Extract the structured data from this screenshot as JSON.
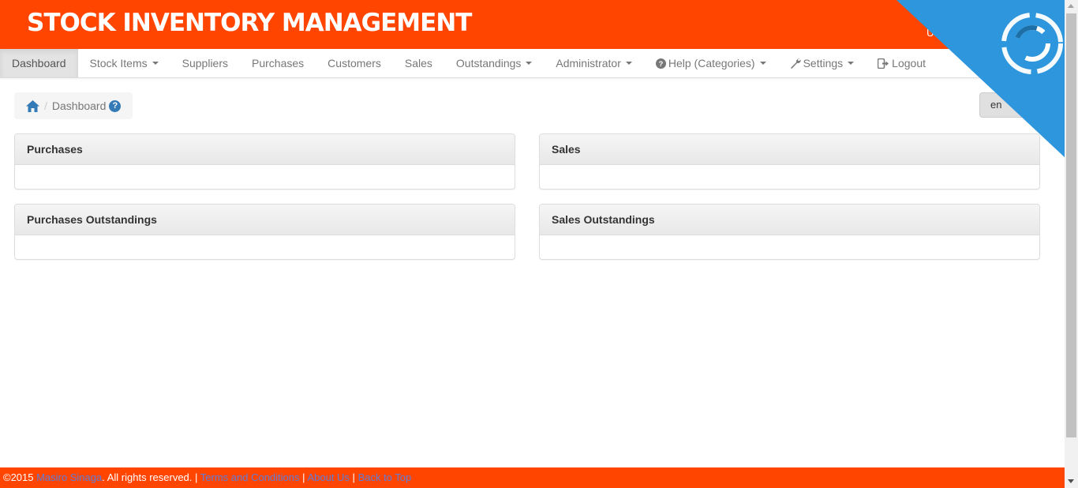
{
  "header": {
    "title": "STOCK INVENTORY MANAGEMENT",
    "user_label": "User Nan"
  },
  "nav": {
    "items": [
      {
        "label": "Dashboard",
        "active": true,
        "dropdown": false,
        "icon": ""
      },
      {
        "label": "Stock Items",
        "active": false,
        "dropdown": true,
        "icon": ""
      },
      {
        "label": "Suppliers",
        "active": false,
        "dropdown": false,
        "icon": ""
      },
      {
        "label": "Purchases",
        "active": false,
        "dropdown": false,
        "icon": ""
      },
      {
        "label": "Customers",
        "active": false,
        "dropdown": false,
        "icon": ""
      },
      {
        "label": "Sales",
        "active": false,
        "dropdown": false,
        "icon": ""
      },
      {
        "label": "Outstandings",
        "active": false,
        "dropdown": true,
        "icon": ""
      },
      {
        "label": "Administrator",
        "active": false,
        "dropdown": true,
        "icon": ""
      },
      {
        "label": "Help (Categories)",
        "active": false,
        "dropdown": true,
        "icon": "question-circle-icon"
      },
      {
        "label": "Settings",
        "active": false,
        "dropdown": true,
        "icon": "wrench-icon"
      },
      {
        "label": "Logout",
        "active": false,
        "dropdown": false,
        "icon": "logout-icon"
      }
    ]
  },
  "breadcrumb": {
    "home_icon": "home-icon",
    "separator": "/",
    "current": "Dashboard",
    "help_icon": "question-circle-icon",
    "help_glyph": "?"
  },
  "language": {
    "value": "en"
  },
  "panels": [
    {
      "title": "Purchases"
    },
    {
      "title": "Sales"
    },
    {
      "title": "Purchases Outstandings"
    },
    {
      "title": "Sales Outstandings"
    }
  ],
  "footer": {
    "copyright": "©2015",
    "author": "Masiro Sinaga",
    "rights": ". All rights reserved. |",
    "terms": "Terms and Conditions",
    "sep1": "|",
    "about": "About Us",
    "sep2": "|",
    "back_to_top": "Back to Top"
  },
  "colors": {
    "brand": "#ff4500",
    "ribbon": "#2d96dd",
    "link": "#5f7dd9"
  }
}
